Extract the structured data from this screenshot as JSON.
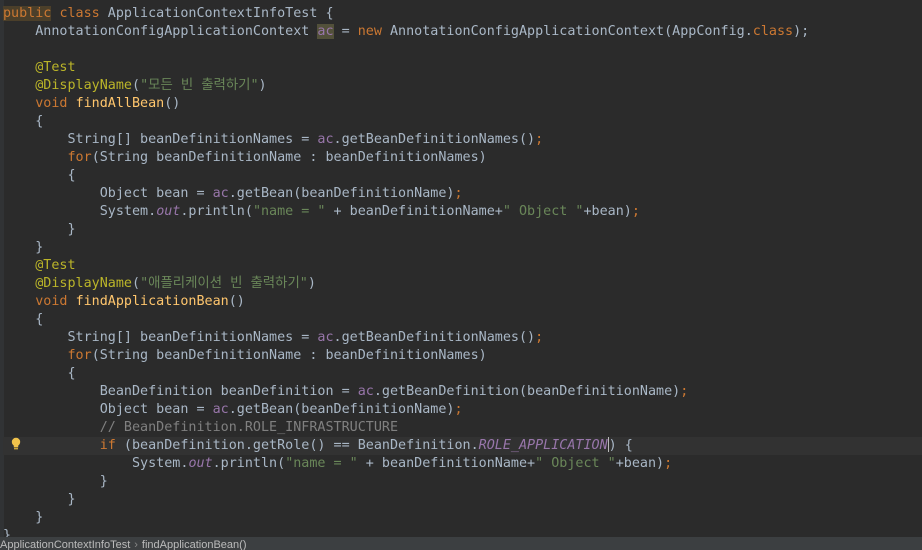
{
  "editor": {
    "language": "java",
    "colors": {
      "background": "#2b2b2b",
      "keyword": "#cc7832",
      "annotation": "#bbb529",
      "method_declaration": "#ffc66d",
      "string": "#6a8759",
      "comment": "#808080",
      "field": "#9876aa",
      "plain": "#a9b7c6"
    },
    "current_line_index": 24,
    "lines": [
      [
        [
          "kw",
          "public"
        ],
        [
          "pln",
          " "
        ],
        [
          "kw",
          "class"
        ],
        [
          "pln",
          " ApplicationContextInfoTest {"
        ]
      ],
      [
        [
          "pln",
          "    AnnotationConfigApplicationContext "
        ],
        [
          "var",
          "ac"
        ],
        [
          "pln",
          " = "
        ],
        [
          "kw",
          "new"
        ],
        [
          "pln",
          " AnnotationConfigApplicationContext(AppConfig."
        ],
        [
          "kw",
          "class"
        ],
        [
          "pln",
          ");"
        ]
      ],
      [
        [
          "pln",
          ""
        ]
      ],
      [
        [
          "ann",
          "    @Test"
        ]
      ],
      [
        [
          "ann",
          "    @DisplayName"
        ],
        [
          "pln",
          "("
        ],
        [
          "str",
          "\"모든 빈 출력하기\""
        ],
        [
          "pln",
          ")"
        ]
      ],
      [
        [
          "pln",
          "    "
        ],
        [
          "kw",
          "void"
        ],
        [
          "pln",
          " "
        ],
        [
          "fn",
          "findAllBean"
        ],
        [
          "pln",
          "()"
        ]
      ],
      [
        [
          "pln",
          "    {"
        ]
      ],
      [
        [
          "pln",
          "        String[] beanDefinitionNames = "
        ],
        [
          "var",
          "ac"
        ],
        [
          "pln",
          ".getBeanDefinitionNames()"
        ],
        [
          "kw",
          ";"
        ]
      ],
      [
        [
          "pln",
          "        "
        ],
        [
          "kw",
          "for"
        ],
        [
          "pln",
          "(String beanDefinitionName : beanDefinitionNames)"
        ]
      ],
      [
        [
          "pln",
          "        {"
        ]
      ],
      [
        [
          "pln",
          "            Object bean = "
        ],
        [
          "var",
          "ac"
        ],
        [
          "pln",
          ".getBean(beanDefinitionName)"
        ],
        [
          "kw",
          ";"
        ]
      ],
      [
        [
          "pln",
          "            System."
        ],
        [
          "sfld",
          "out"
        ],
        [
          "pln",
          ".println("
        ],
        [
          "str",
          "\"name = \""
        ],
        [
          "pln",
          " + beanDefinitionName+"
        ],
        [
          "str",
          "\" Object \""
        ],
        [
          "pln",
          "+bean)"
        ],
        [
          "kw",
          ";"
        ]
      ],
      [
        [
          "pln",
          "        }"
        ]
      ],
      [
        [
          "pln",
          "    }"
        ]
      ],
      [
        [
          "ann",
          "    @Test"
        ]
      ],
      [
        [
          "ann",
          "    @DisplayName"
        ],
        [
          "pln",
          "("
        ],
        [
          "str",
          "\"애플리케이션 빈 출력하기\""
        ],
        [
          "pln",
          ")"
        ]
      ],
      [
        [
          "pln",
          "    "
        ],
        [
          "kw",
          "void"
        ],
        [
          "pln",
          " "
        ],
        [
          "fn",
          "findApplicationBean"
        ],
        [
          "pln",
          "()"
        ]
      ],
      [
        [
          "pln",
          "    {"
        ]
      ],
      [
        [
          "pln",
          "        String[] beanDefinitionNames = "
        ],
        [
          "var",
          "ac"
        ],
        [
          "pln",
          ".getBeanDefinitionNames()"
        ],
        [
          "kw",
          ";"
        ]
      ],
      [
        [
          "pln",
          "        "
        ],
        [
          "kw",
          "for"
        ],
        [
          "pln",
          "(String beanDefinitionName : beanDefinitionNames)"
        ]
      ],
      [
        [
          "pln",
          "        {"
        ]
      ],
      [
        [
          "pln",
          "            BeanDefinition beanDefinition = "
        ],
        [
          "var",
          "ac"
        ],
        [
          "pln",
          ".getBeanDefinition(beanDefinitionName)"
        ],
        [
          "kw",
          ";"
        ]
      ],
      [
        [
          "pln",
          "            Object bean = "
        ],
        [
          "var",
          "ac"
        ],
        [
          "pln",
          ".getBean(beanDefinitionName)"
        ],
        [
          "kw",
          ";"
        ]
      ],
      [
        [
          "cm",
          "            // BeanDefinition.ROLE_INFRASTRUCTURE"
        ]
      ],
      [
        [
          "pln",
          "            "
        ],
        [
          "kw",
          "if"
        ],
        [
          "pln",
          " (beanDefinition.getRole() == BeanDefinition."
        ],
        [
          "sfld",
          "ROLE_APPLICATION"
        ],
        [
          "caret",
          ""
        ],
        [
          "pln",
          ") {"
        ]
      ],
      [
        [
          "pln",
          "                System."
        ],
        [
          "sfld",
          "out"
        ],
        [
          "pln",
          ".println("
        ],
        [
          "str",
          "\"name = \""
        ],
        [
          "pln",
          " + beanDefinitionName+"
        ],
        [
          "str",
          "\" Object \""
        ],
        [
          "pln",
          "+bean)"
        ],
        [
          "kw",
          ";"
        ]
      ],
      [
        [
          "pln",
          "            }"
        ]
      ],
      [
        [
          "pln",
          "        }"
        ]
      ],
      [
        [
          "pln",
          "    }"
        ]
      ],
      [
        [
          "pln",
          "}"
        ]
      ]
    ]
  },
  "gutter": {
    "intention_icon": "lightbulb-icon"
  },
  "status_bar": {
    "breadcrumb": [
      "ApplicationContextInfoTest",
      "findApplicationBean()"
    ]
  }
}
